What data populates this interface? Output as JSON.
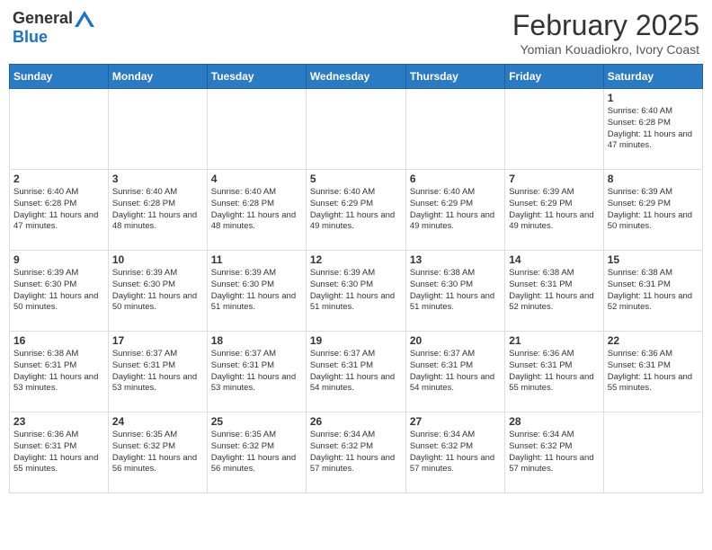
{
  "header": {
    "logo_general": "General",
    "logo_blue": "Blue",
    "month_year": "February 2025",
    "location": "Yomian Kouadiokro, Ivory Coast"
  },
  "weekdays": [
    "Sunday",
    "Monday",
    "Tuesday",
    "Wednesday",
    "Thursday",
    "Friday",
    "Saturday"
  ],
  "weeks": [
    [
      {
        "day": "",
        "info": ""
      },
      {
        "day": "",
        "info": ""
      },
      {
        "day": "",
        "info": ""
      },
      {
        "day": "",
        "info": ""
      },
      {
        "day": "",
        "info": ""
      },
      {
        "day": "",
        "info": ""
      },
      {
        "day": "1",
        "info": "Sunrise: 6:40 AM\nSunset: 6:28 PM\nDaylight: 11 hours and 47 minutes."
      }
    ],
    [
      {
        "day": "2",
        "info": "Sunrise: 6:40 AM\nSunset: 6:28 PM\nDaylight: 11 hours and 47 minutes."
      },
      {
        "day": "3",
        "info": "Sunrise: 6:40 AM\nSunset: 6:28 PM\nDaylight: 11 hours and 48 minutes."
      },
      {
        "day": "4",
        "info": "Sunrise: 6:40 AM\nSunset: 6:28 PM\nDaylight: 11 hours and 48 minutes."
      },
      {
        "day": "5",
        "info": "Sunrise: 6:40 AM\nSunset: 6:29 PM\nDaylight: 11 hours and 49 minutes."
      },
      {
        "day": "6",
        "info": "Sunrise: 6:40 AM\nSunset: 6:29 PM\nDaylight: 11 hours and 49 minutes."
      },
      {
        "day": "7",
        "info": "Sunrise: 6:39 AM\nSunset: 6:29 PM\nDaylight: 11 hours and 49 minutes."
      },
      {
        "day": "8",
        "info": "Sunrise: 6:39 AM\nSunset: 6:29 PM\nDaylight: 11 hours and 50 minutes."
      }
    ],
    [
      {
        "day": "9",
        "info": "Sunrise: 6:39 AM\nSunset: 6:30 PM\nDaylight: 11 hours and 50 minutes."
      },
      {
        "day": "10",
        "info": "Sunrise: 6:39 AM\nSunset: 6:30 PM\nDaylight: 11 hours and 50 minutes."
      },
      {
        "day": "11",
        "info": "Sunrise: 6:39 AM\nSunset: 6:30 PM\nDaylight: 11 hours and 51 minutes."
      },
      {
        "day": "12",
        "info": "Sunrise: 6:39 AM\nSunset: 6:30 PM\nDaylight: 11 hours and 51 minutes."
      },
      {
        "day": "13",
        "info": "Sunrise: 6:38 AM\nSunset: 6:30 PM\nDaylight: 11 hours and 51 minutes."
      },
      {
        "day": "14",
        "info": "Sunrise: 6:38 AM\nSunset: 6:31 PM\nDaylight: 11 hours and 52 minutes."
      },
      {
        "day": "15",
        "info": "Sunrise: 6:38 AM\nSunset: 6:31 PM\nDaylight: 11 hours and 52 minutes."
      }
    ],
    [
      {
        "day": "16",
        "info": "Sunrise: 6:38 AM\nSunset: 6:31 PM\nDaylight: 11 hours and 53 minutes."
      },
      {
        "day": "17",
        "info": "Sunrise: 6:37 AM\nSunset: 6:31 PM\nDaylight: 11 hours and 53 minutes."
      },
      {
        "day": "18",
        "info": "Sunrise: 6:37 AM\nSunset: 6:31 PM\nDaylight: 11 hours and 53 minutes."
      },
      {
        "day": "19",
        "info": "Sunrise: 6:37 AM\nSunset: 6:31 PM\nDaylight: 11 hours and 54 minutes."
      },
      {
        "day": "20",
        "info": "Sunrise: 6:37 AM\nSunset: 6:31 PM\nDaylight: 11 hours and 54 minutes."
      },
      {
        "day": "21",
        "info": "Sunrise: 6:36 AM\nSunset: 6:31 PM\nDaylight: 11 hours and 55 minutes."
      },
      {
        "day": "22",
        "info": "Sunrise: 6:36 AM\nSunset: 6:31 PM\nDaylight: 11 hours and 55 minutes."
      }
    ],
    [
      {
        "day": "23",
        "info": "Sunrise: 6:36 AM\nSunset: 6:31 PM\nDaylight: 11 hours and 55 minutes."
      },
      {
        "day": "24",
        "info": "Sunrise: 6:35 AM\nSunset: 6:32 PM\nDaylight: 11 hours and 56 minutes."
      },
      {
        "day": "25",
        "info": "Sunrise: 6:35 AM\nSunset: 6:32 PM\nDaylight: 11 hours and 56 minutes."
      },
      {
        "day": "26",
        "info": "Sunrise: 6:34 AM\nSunset: 6:32 PM\nDaylight: 11 hours and 57 minutes."
      },
      {
        "day": "27",
        "info": "Sunrise: 6:34 AM\nSunset: 6:32 PM\nDaylight: 11 hours and 57 minutes."
      },
      {
        "day": "28",
        "info": "Sunrise: 6:34 AM\nSunset: 6:32 PM\nDaylight: 11 hours and 57 minutes."
      },
      {
        "day": "",
        "info": ""
      }
    ]
  ]
}
